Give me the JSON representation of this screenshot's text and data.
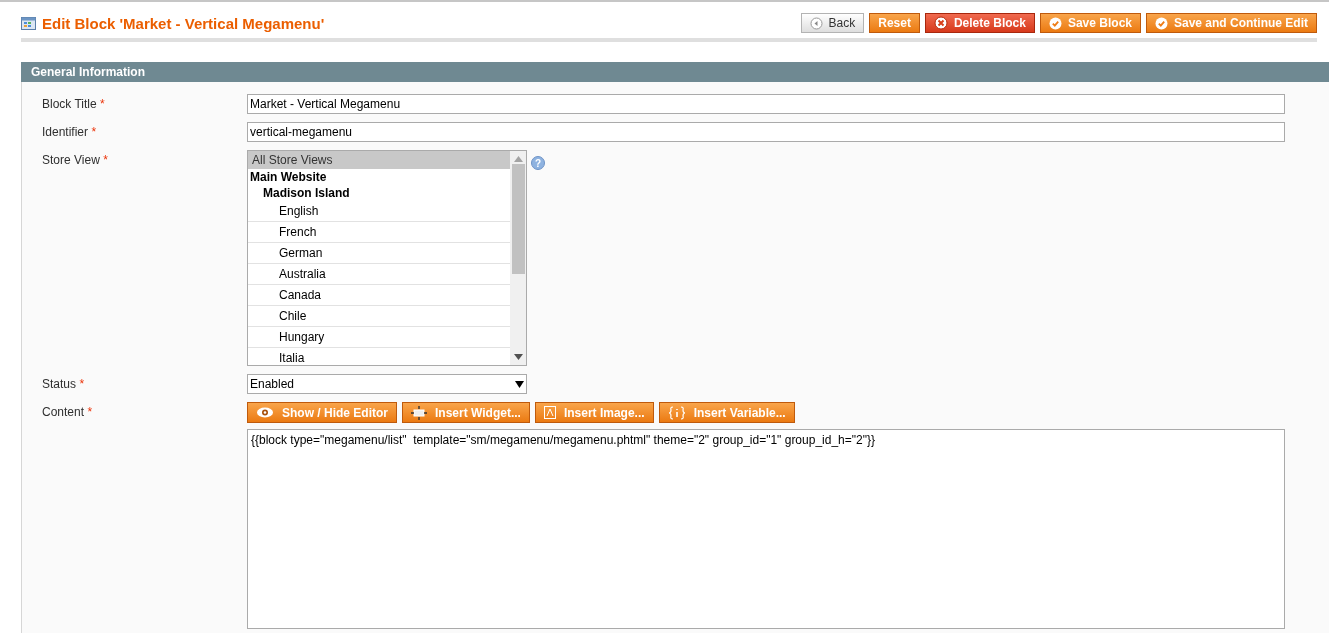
{
  "header": {
    "title": "Edit Block 'Market - Vertical Megamenu'"
  },
  "actions": [
    {
      "label": "Back",
      "kind": "back"
    },
    {
      "label": "Reset",
      "kind": "plain"
    },
    {
      "label": "Delete Block",
      "kind": "delete"
    },
    {
      "label": "Save Block",
      "kind": "save"
    },
    {
      "label": "Save and Continue Edit",
      "kind": "save"
    }
  ],
  "section": {
    "title": "General Information"
  },
  "fields": {
    "block_title": {
      "label": "Block Title",
      "required_mark": "*",
      "value": "Market - Vertical Megamenu"
    },
    "identifier": {
      "label": "Identifier",
      "required_mark": "*",
      "value": "vertical-megamenu"
    },
    "store_view": {
      "label": "Store View",
      "required_mark": "*",
      "help": "?",
      "options": [
        {
          "label": "All Store Views",
          "kind": "all",
          "selected": true
        },
        {
          "label": "Main Website",
          "kind": "website",
          "selected": false
        },
        {
          "label": "Madison Island",
          "kind": "group",
          "selected": false
        },
        {
          "label": "English",
          "kind": "store",
          "selected": false
        },
        {
          "label": "French",
          "kind": "store",
          "selected": false
        },
        {
          "label": "German",
          "kind": "store",
          "selected": false
        },
        {
          "label": "Australia",
          "kind": "store",
          "selected": false
        },
        {
          "label": "Canada",
          "kind": "store",
          "selected": false
        },
        {
          "label": "Chile",
          "kind": "store",
          "selected": false
        },
        {
          "label": "Hungary",
          "kind": "store",
          "selected": false
        },
        {
          "label": "Italia",
          "kind": "store",
          "selected": false
        }
      ]
    },
    "status": {
      "label": "Status",
      "required_mark": "*",
      "value": "Enabled"
    },
    "content": {
      "label": "Content",
      "required_mark": "*",
      "value": "{{block type=\"megamenu/list\"  template=\"sm/megamenu/megamenu.phtml\" theme=\"2\" group_id=\"1\" group_id_h=\"2\"}}"
    }
  },
  "editor_buttons": [
    {
      "label": "Show / Hide Editor",
      "kind": "eye"
    },
    {
      "label": "Insert Widget...",
      "kind": "widget"
    },
    {
      "label": "Insert Image...",
      "kind": "image"
    },
    {
      "label": "Insert Variable...",
      "kind": "variable"
    }
  ]
}
